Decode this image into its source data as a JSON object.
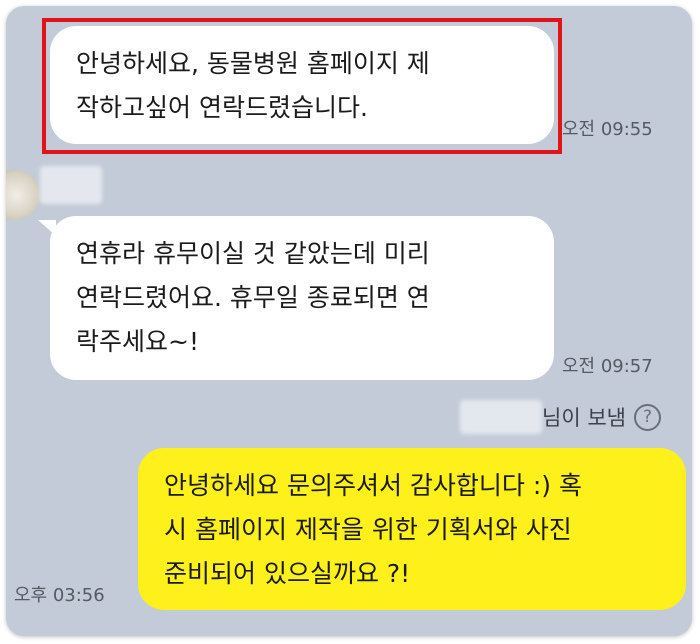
{
  "messages": [
    {
      "direction": "incoming",
      "lines": [
        "안녕하세요, 동물병원 홈페이지 제",
        "작하고싶어 연락드렸습니다."
      ],
      "time": "오전 09:55",
      "highlighted": true
    },
    {
      "direction": "incoming",
      "lines": [
        "연휴라 휴무이실 것 같았는데 미리",
        "연락드렸어요. 휴무일 종료되면 연",
        "락주세요~!"
      ],
      "time": "오전 09:57"
    },
    {
      "direction": "outgoing",
      "sender_suffix": "님이 보냄",
      "help_icon": "?",
      "lines": [
        "안녕하세요 문의주셔서 감사합니다 :) 혹",
        "시 홈페이지 제작을 위한 기획서와 사진",
        "준비되어 있으실까요 ?!"
      ],
      "time": "오후 03:56"
    }
  ],
  "colors": {
    "background": "#c3cbd8",
    "incoming_bubble": "#ffffff",
    "outgoing_bubble": "#fef01b",
    "highlight": "#e0141b"
  }
}
